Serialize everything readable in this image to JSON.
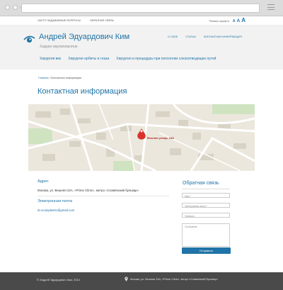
{
  "topbar": {
    "links": [
      "ЧАСТО ЗАДАВАЕМЫЕ ВОПРОСЫ",
      "ОБРАТНАЯ СВЯЗЬ"
    ],
    "font_label": "Размер шрифта",
    "font_sizes": [
      "A",
      "A",
      "A"
    ]
  },
  "header": {
    "title": "Андрей Эдуардович Ким",
    "subtitle": "Хирург-окулопластик",
    "nav_right": [
      "О СЕБЕ",
      "СТАТЬИ",
      "КОНТАКТНАЯ ИНФОРМАЦИЯ"
    ],
    "nav_main": [
      "Хирургия век",
      "Хирургия орбиты и глаза",
      "Хирургия и процедуры при патологии слезоотводящих путей"
    ]
  },
  "breadcrumb": {
    "home": "Главная",
    "separator": "/",
    "current": "Контактная информация"
  },
  "page_title": "Контактная информация",
  "map": {
    "marker_label": "Вешняя улица, 24А"
  },
  "address": {
    "title": "Адрес",
    "text": "Москва, ул. Вешняя 24А, «Prime Clinic», метро «Славянский бульвар»"
  },
  "email": {
    "title": "Электронная почта",
    "text": "dr.oculoplastic@gmail.com"
  },
  "form": {
    "title": "Обратная связь",
    "name_placeholder": "Имя *",
    "email_placeholder": "Электронная почта *",
    "phone_placeholder": "Телефон",
    "message_placeholder": "Сообщение",
    "submit": "Отправить"
  },
  "footer": {
    "copyright": "© Андрей Эдуардович Ким, 2014",
    "address": "Москва, ул. Вешняя 24А, «Prime Clinic», метро «Славянский бульвар»"
  },
  "colors": {
    "accent": "#1f73a6",
    "footer_bg": "#4a4a4a",
    "header_bg": "#f2f2f2",
    "marker": "#d9332b"
  }
}
